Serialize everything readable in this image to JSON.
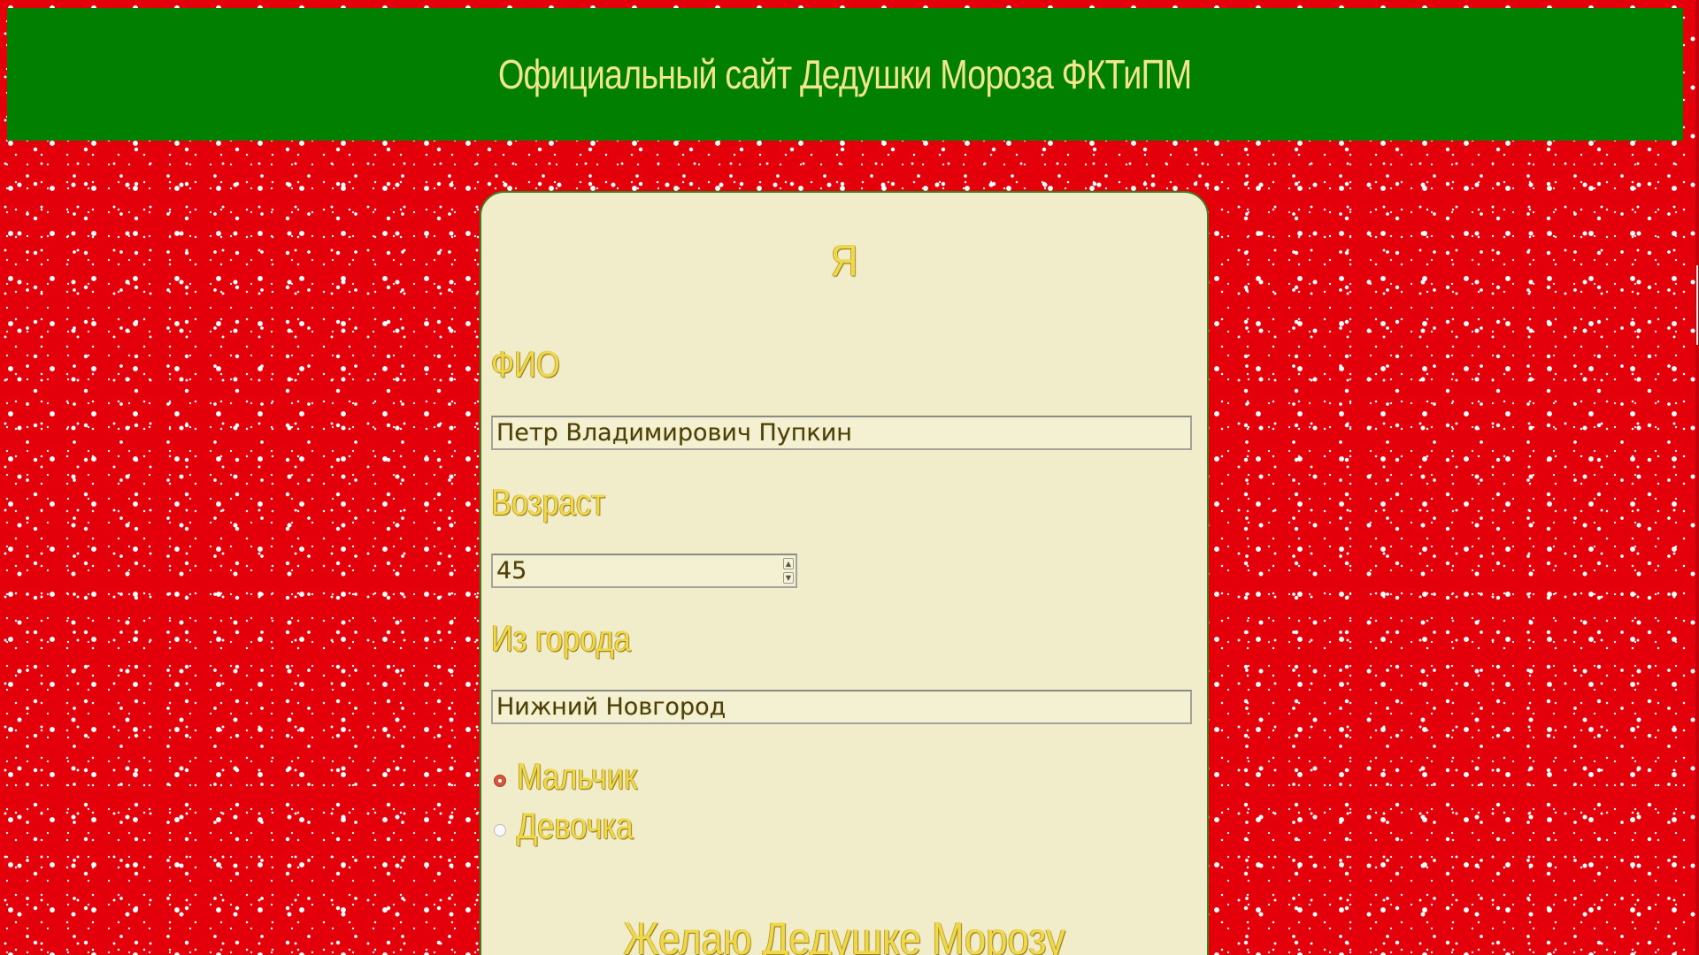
{
  "header": {
    "title": "Официальный сайт Дедушки Мороза ФКТиПМ"
  },
  "form": {
    "title": "Я",
    "fio_label": "ФИО",
    "fio_value": "Петр Владимирович Пупкин",
    "age_label": "Возраст",
    "age_value": "45",
    "city_label": "Из города",
    "city_value": "Нижний Новгород",
    "gender": {
      "options": [
        "Мальчик",
        "Девочка"
      ],
      "selected": "Мальчик"
    },
    "wish_heading": "Желаю Дедушке Морозу"
  },
  "colors": {
    "background": "#e3000b",
    "header": "#017f01",
    "header_text": "#f0e68c",
    "card": "#f1edca",
    "heading_text": "#f0d84b"
  }
}
